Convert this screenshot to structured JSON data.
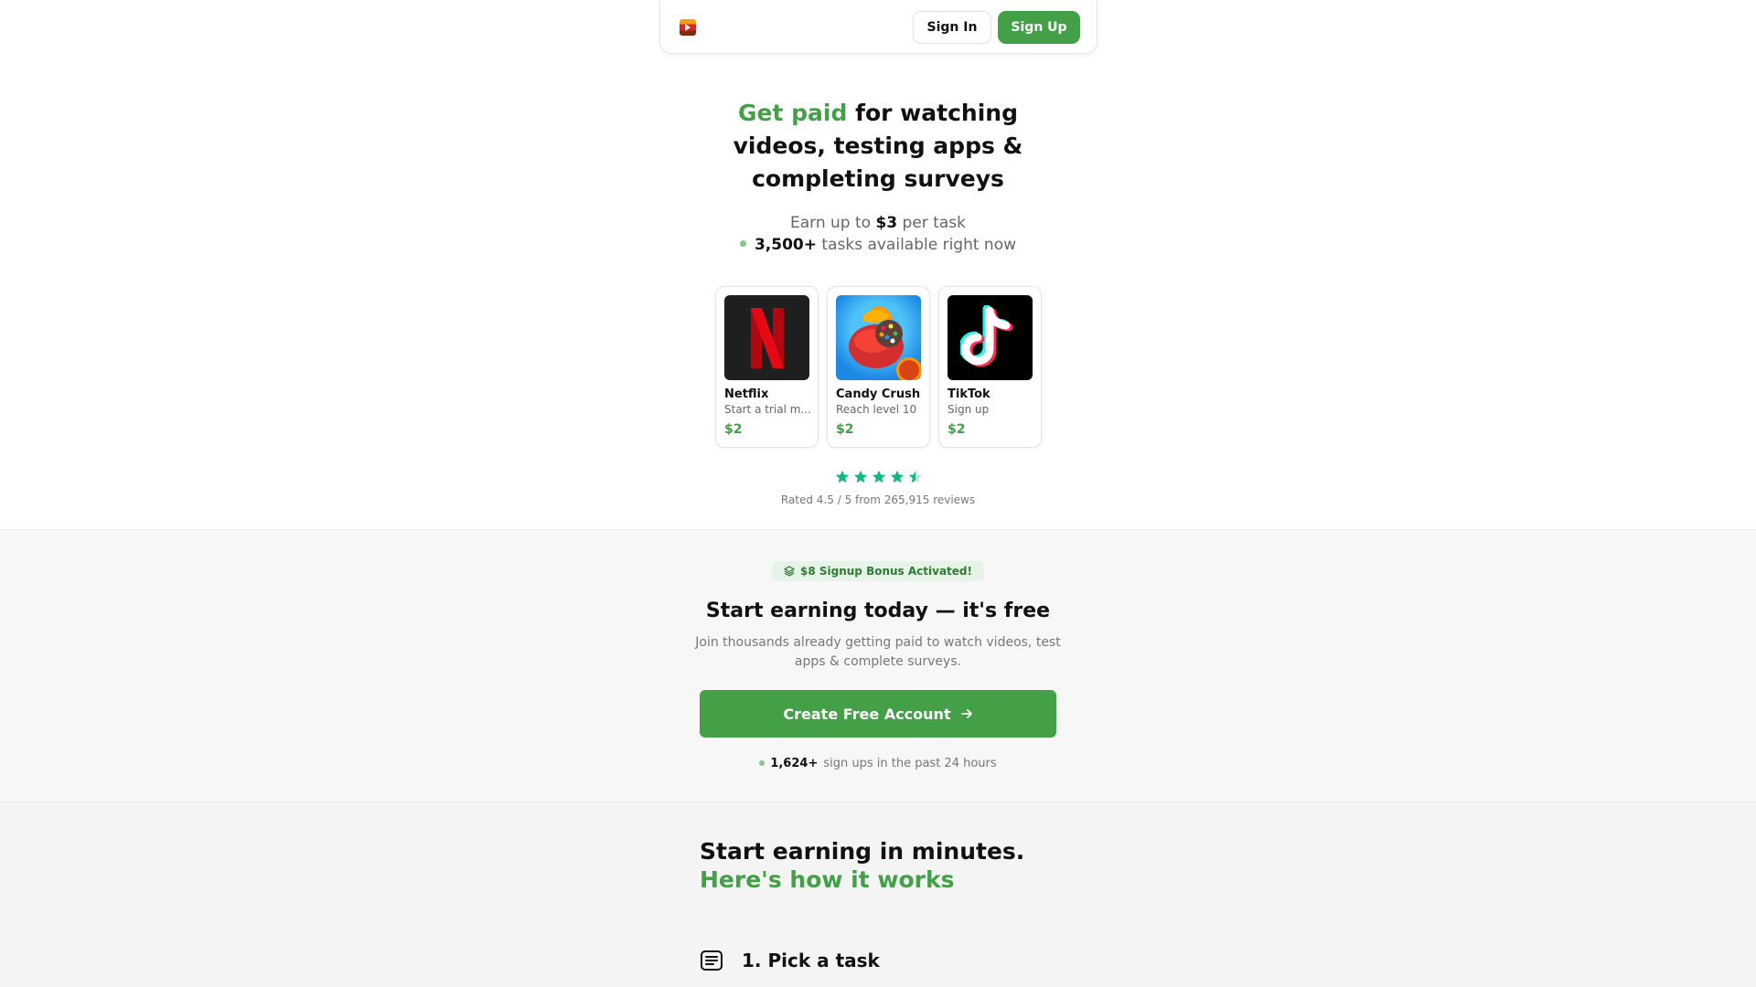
{
  "nav": {
    "sign_in": "Sign In",
    "sign_up": "Sign Up"
  },
  "hero": {
    "title_accent": "Get paid",
    "title_rest": " for watching videos, testing apps & completing surveys",
    "earn_prefix": "Earn up to ",
    "earn_amount": "$3",
    "earn_suffix": " per task",
    "tasks_count": "3,500+",
    "tasks_suffix": " tasks available right now"
  },
  "tasks": [
    {
      "name": "Netflix",
      "desc": "Start a trial m...",
      "price": "$2",
      "icon": "netflix-logo"
    },
    {
      "name": "Candy Crush",
      "desc": "Reach level 10",
      "price": "$2",
      "icon": "candy-crush-logo"
    },
    {
      "name": "TikTok",
      "desc": "Sign up",
      "price": "$2",
      "icon": "tiktok-logo"
    }
  ],
  "rating": {
    "stars": 4.5,
    "text": "Rated 4.5 / 5 from 265,915 reviews"
  },
  "signup": {
    "bonus": "$8 Signup Bonus Activated!",
    "title": "Start earning today — it's free",
    "desc": "Join thousands already getting paid to watch videos, test apps & complete surveys.",
    "cta": "Create Free Account",
    "signups_count": "1,624+",
    "signups_suffix": "sign ups in the past 24 hours"
  },
  "how": {
    "title_line1": "Start earning in minutes.",
    "title_line2": "Here's how it works",
    "step1": "1. Pick a task"
  },
  "colors": {
    "accent": "#43a047",
    "star": "#10b981"
  }
}
